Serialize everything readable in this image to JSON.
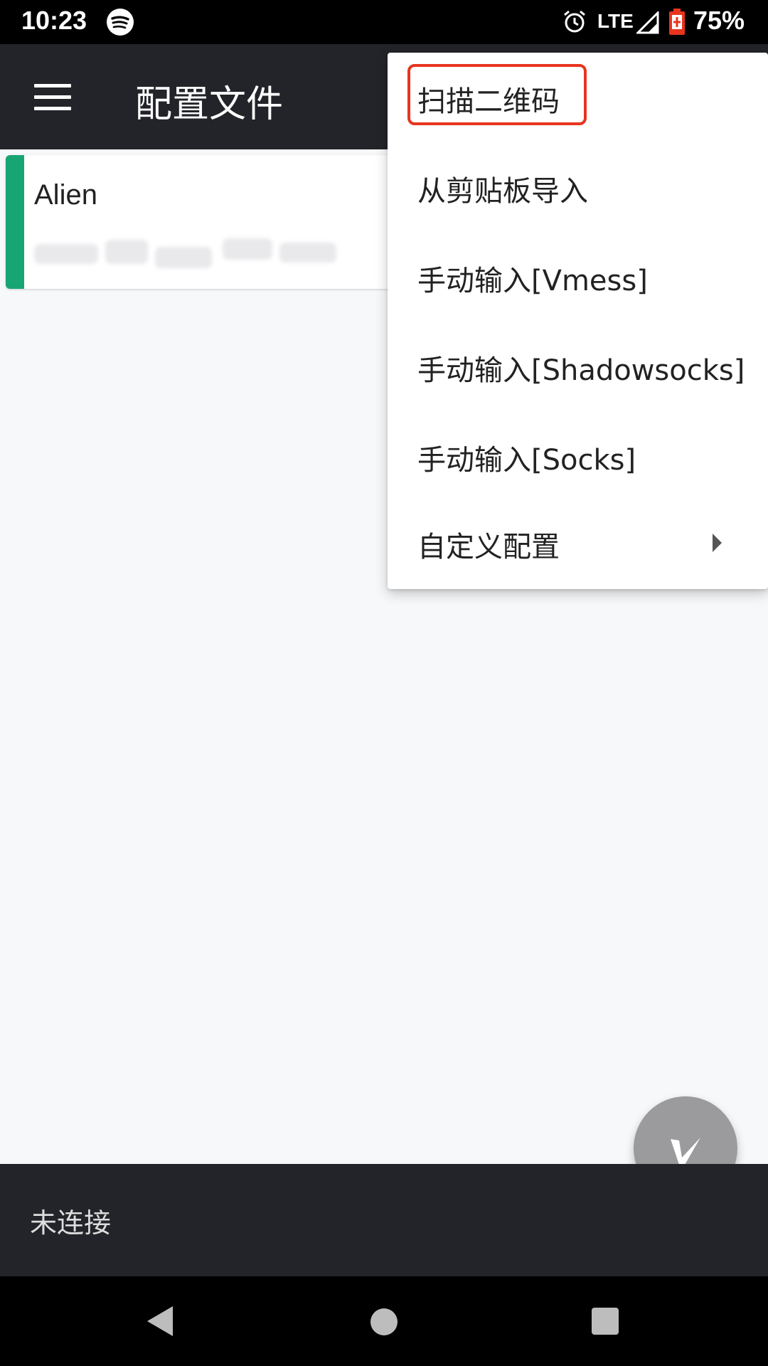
{
  "status_bar": {
    "time": "10:23",
    "network": "LTE",
    "battery": "75%"
  },
  "app_bar": {
    "title": "配置文件"
  },
  "servers": [
    {
      "name": "Alien",
      "address": ""
    }
  ],
  "dropdown": {
    "items": [
      {
        "label": "扫描二维码"
      },
      {
        "label": "从剪贴板导入"
      },
      {
        "label": "手动输入[Vmess]"
      },
      {
        "label": "手动输入[Shadowsocks]"
      },
      {
        "label": "手动输入[Socks]"
      },
      {
        "label": "自定义配置"
      }
    ]
  },
  "bottom_bar": {
    "status": "未连接"
  },
  "colors": {
    "app_bar": "#232429",
    "accent_green": "#17a673",
    "highlight_red": "#e8341f",
    "fab": "#9b9b9d"
  }
}
